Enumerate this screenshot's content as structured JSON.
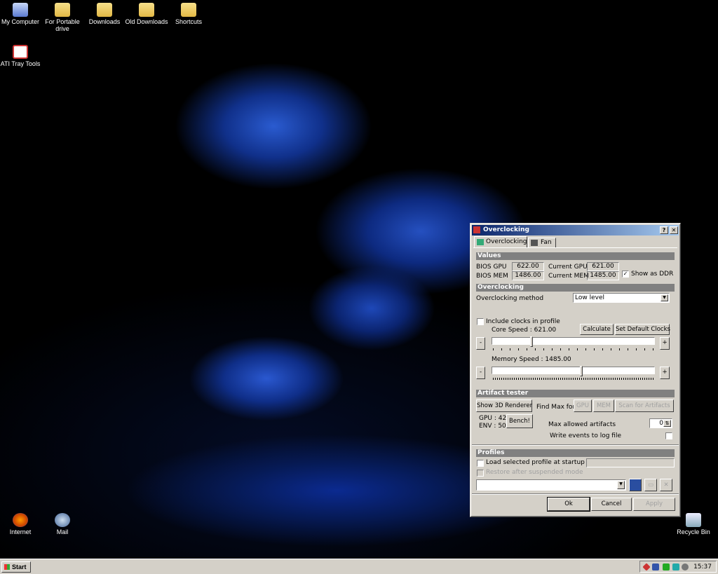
{
  "desktop": {
    "icons": [
      {
        "label": "My Computer"
      },
      {
        "label": "For Portable drive"
      },
      {
        "label": "Downloads"
      },
      {
        "label": "Old Downloads"
      },
      {
        "label": "Shortcuts"
      },
      {
        "label": "ATI Tray Tools"
      },
      {
        "label": "Internet"
      },
      {
        "label": "Mail"
      },
      {
        "label": "Recycle Bin"
      }
    ]
  },
  "taskbar": {
    "start": "Start",
    "clock": "15:37"
  },
  "dialog": {
    "title": "Overclocking",
    "help": "?",
    "close": "✕",
    "tabs": [
      {
        "label": "Overclocking"
      },
      {
        "label": "Fan"
      }
    ],
    "values": {
      "header": "Values",
      "bios_gpu_label": "BIOS GPU",
      "bios_gpu": "622.00",
      "bios_mem_label": "BIOS MEM",
      "bios_mem": "1486.00",
      "cur_gpu_label": "Current GPU",
      "cur_gpu": "621.00",
      "cur_mem_label": "Current MEM",
      "cur_mem": "1485.00",
      "show_ddr": "Show as DDR",
      "show_ddr_checked": true
    },
    "overclocking": {
      "header": "Overclocking",
      "method_label": "Overclocking method",
      "method": "Low level",
      "include_clocks": "Include clocks in profile",
      "core_speed": "Core Speed : 621.00",
      "core_pos": 0.24,
      "memory_speed": "Memory Speed : 1485.00",
      "mem_pos": 0.55,
      "calculate": "Calculate",
      "set_default": "Set Default Clocks",
      "minus": "-",
      "plus": "+"
    },
    "artifact": {
      "header": "Artifact tester",
      "show_3d": "Show 3D Renderer",
      "find_max": "Find Max for",
      "gpu_btn": "GPU",
      "mem_btn": "MEM",
      "scan": "Scan for Artifacts",
      "gpu_temp": "GPU : 42",
      "env_temp": "ENV : 50",
      "bench": "Bench!",
      "max_allowed": "Max allowed artifacts",
      "max_value": "0",
      "write_log": "Write events to log file"
    },
    "profiles": {
      "header": "Profiles",
      "load_startup": "Load selected profile at startup",
      "restore": "Restore after suspended mode",
      "profile_value": ""
    },
    "buttons": {
      "ok": "Ok",
      "cancel": "Cancel",
      "apply": "Apply"
    }
  }
}
